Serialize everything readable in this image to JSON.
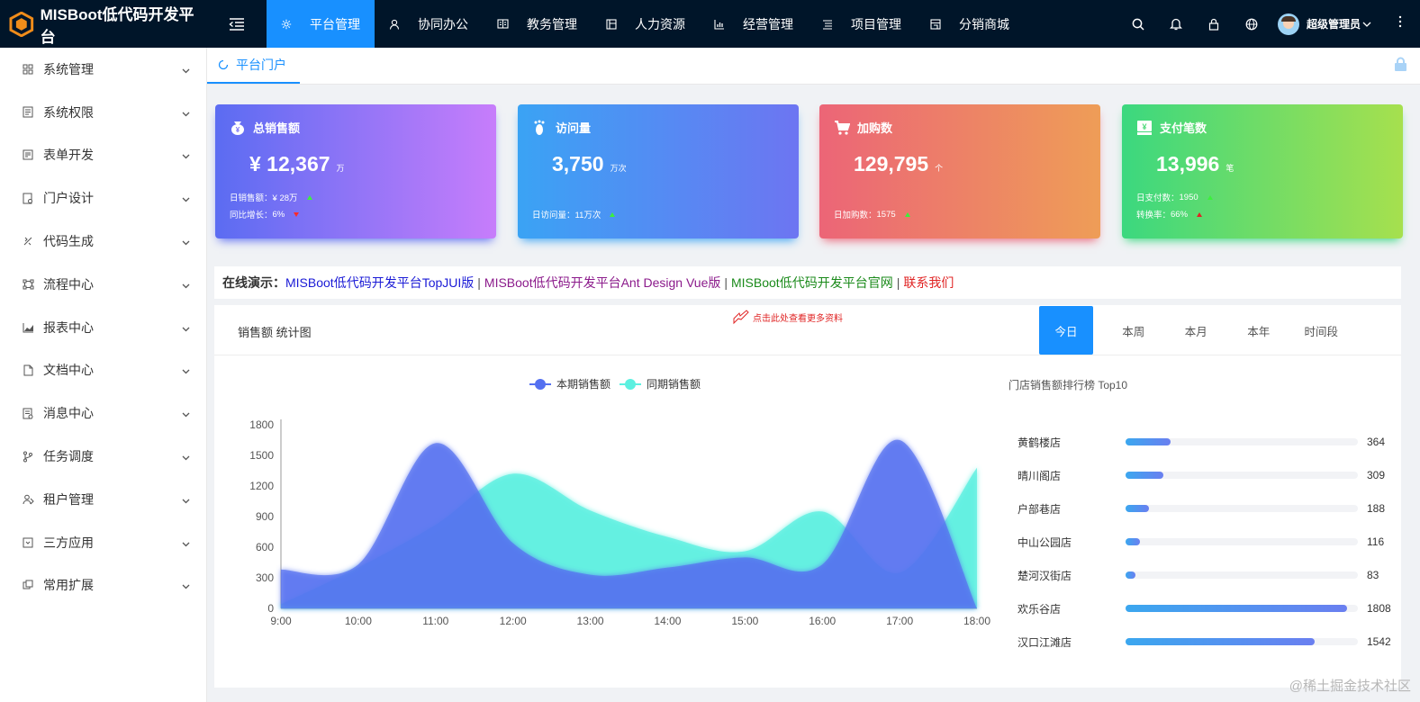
{
  "app": {
    "title": "MISBoot低代码开发平台"
  },
  "topnav": [
    {
      "label": "平台管理",
      "icon": "gear-icon",
      "active": true
    },
    {
      "label": "协同办公",
      "icon": "user-icon"
    },
    {
      "label": "教务管理",
      "icon": "book-icon"
    },
    {
      "label": "人力资源",
      "icon": "layout-icon"
    },
    {
      "label": "经营管理",
      "icon": "bar-chart-icon"
    },
    {
      "label": "项目管理",
      "icon": "list-icon"
    },
    {
      "label": "分销商城",
      "icon": "store-icon"
    }
  ],
  "user": {
    "name": "超级管理员"
  },
  "sidebar": {
    "items": [
      {
        "label": "系统管理",
        "icon": "grid-icon"
      },
      {
        "label": "系统权限",
        "icon": "doc-icon"
      },
      {
        "label": "表单开发",
        "icon": "form-icon"
      },
      {
        "label": "门户设计",
        "icon": "portal-icon"
      },
      {
        "label": "代码生成",
        "icon": "code-icon"
      },
      {
        "label": "流程中心",
        "icon": "flow-icon"
      },
      {
        "label": "报表中心",
        "icon": "area-chart-icon"
      },
      {
        "label": "文档中心",
        "icon": "file-icon"
      },
      {
        "label": "消息中心",
        "icon": "message-icon"
      },
      {
        "label": "任务调度",
        "icon": "branch-icon"
      },
      {
        "label": "租户管理",
        "icon": "tenant-icon"
      },
      {
        "label": "三方应用",
        "icon": "app-icon"
      },
      {
        "label": "常用扩展",
        "icon": "extension-icon"
      }
    ]
  },
  "tabs": [
    {
      "label": "平台门户"
    }
  ],
  "cards": [
    {
      "title": "总销售额",
      "value": "¥ 12,367",
      "unit": "万",
      "sub1_label": "日销售额：",
      "sub1_value": "¥ 28万",
      "sub1_trend": "up",
      "sub2_label": "同比增长：",
      "sub2_value": "6%",
      "sub2_trend": "down",
      "gradient": [
        "#5b6cf2",
        "#c77dfb"
      ]
    },
    {
      "title": "访问量",
      "value": "3,750",
      "unit": "万次",
      "sub1_label": "日访问量：",
      "sub1_value": "11万次",
      "sub1_trend": "up",
      "gradient": [
        "#3aa3f4",
        "#6d75f2"
      ]
    },
    {
      "title": "加购数",
      "value": "129,795",
      "unit": "个",
      "sub1_label": "日加购数：",
      "sub1_value": "1575",
      "sub1_trend": "up",
      "gradient": [
        "#ec6577",
        "#ee9d57"
      ]
    },
    {
      "title": "支付笔数",
      "value": "13,996",
      "unit": "笔",
      "sub1_label": "日支付数：",
      "sub1_value": "1950",
      "sub1_trend": "up",
      "sub2_label": "转换率：",
      "sub2_value": "66%",
      "sub2_trend": "up-red",
      "gradient": [
        "#3bd87f",
        "#a6e04e"
      ]
    }
  ],
  "links": {
    "label": "在线演示：",
    "items": [
      {
        "text": "MISBoot低代码开发平台TopJUI版",
        "color": "#1a1ad6"
      },
      {
        "text": "MISBoot低代码开发平台Ant Design Vue版",
        "color": "#8b1a8b"
      },
      {
        "text": "MISBoot低代码开发平台官网",
        "color": "#1a8a1a"
      },
      {
        "text": "联系我们",
        "color": "#e02424"
      }
    ],
    "separator": "|"
  },
  "panel": {
    "title": "销售额 统计图",
    "hint": "点击此处查看更多资料",
    "periods": [
      {
        "label": "今日",
        "active": true
      },
      {
        "label": "本周"
      },
      {
        "label": "本月"
      },
      {
        "label": "本年"
      },
      {
        "label": "时间段"
      }
    ]
  },
  "chart_data": [
    {
      "type": "area",
      "title": "",
      "x": [
        "9:00",
        "10:00",
        "11:00",
        "12:00",
        "13:00",
        "14:00",
        "15:00",
        "16:00",
        "17:00",
        "18:00"
      ],
      "ylim": [
        0,
        1800
      ],
      "yticks": [
        0,
        300,
        600,
        900,
        1200,
        1500,
        1800
      ],
      "series": [
        {
          "name": "本期销售额",
          "color": "#5470f0",
          "values": [
            380,
            430,
            1620,
            640,
            330,
            400,
            500,
            430,
            1650,
            0
          ]
        },
        {
          "name": "同期销售额",
          "color": "#5cf0e0",
          "values": [
            40,
            400,
            820,
            1320,
            960,
            700,
            560,
            950,
            350,
            1380
          ]
        }
      ],
      "legend_position": "top-center",
      "grid": false
    },
    {
      "type": "bar",
      "title": "门店销售额排行榜 Top10",
      "categories": [
        "黄鹤楼店",
        "晴川阁店",
        "户部巷店",
        "中山公园店",
        "楚河汉街店",
        "欢乐谷店",
        "汉口江滩店"
      ],
      "values": [
        364,
        309,
        188,
        116,
        83,
        1808,
        1542
      ],
      "orientation": "horizontal"
    }
  ],
  "watermark": "@稀土掘金技术社区"
}
